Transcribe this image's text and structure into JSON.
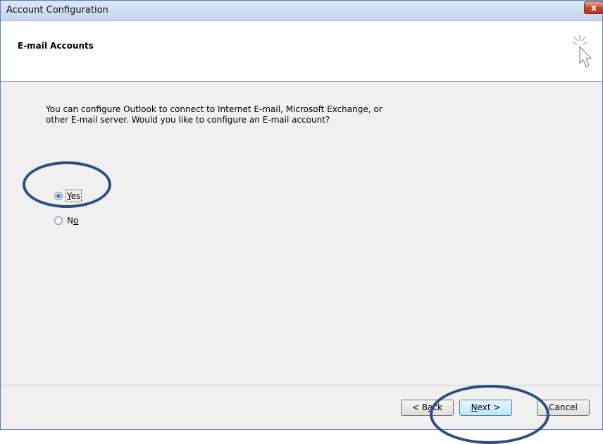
{
  "window": {
    "title": "Account Configuration",
    "close_label": "x"
  },
  "header": {
    "title": "E-mail Accounts",
    "icon": "wizard-cursor-icon"
  },
  "content": {
    "description": "You can configure Outlook to connect to Internet E-mail, Microsoft Exchange, or\nother E-mail server. Would you like to configure an E-mail account?",
    "options": [
      {
        "label_pre": "",
        "accel": "Y",
        "label_post": "es",
        "selected": true
      },
      {
        "label_pre": "N",
        "accel": "o",
        "label_post": "",
        "selected": false
      }
    ]
  },
  "footer": {
    "back": {
      "pre": "< B",
      "accel": "a",
      "post": "ck"
    },
    "next": {
      "pre": "",
      "accel": "N",
      "post": "ext >"
    },
    "cancel": {
      "pre": "",
      "accel": "",
      "post": "Cancel"
    }
  },
  "colors": {
    "annotation": "#2e4d80",
    "title_bar": "#c4d6ee",
    "close": "#c6422a"
  }
}
